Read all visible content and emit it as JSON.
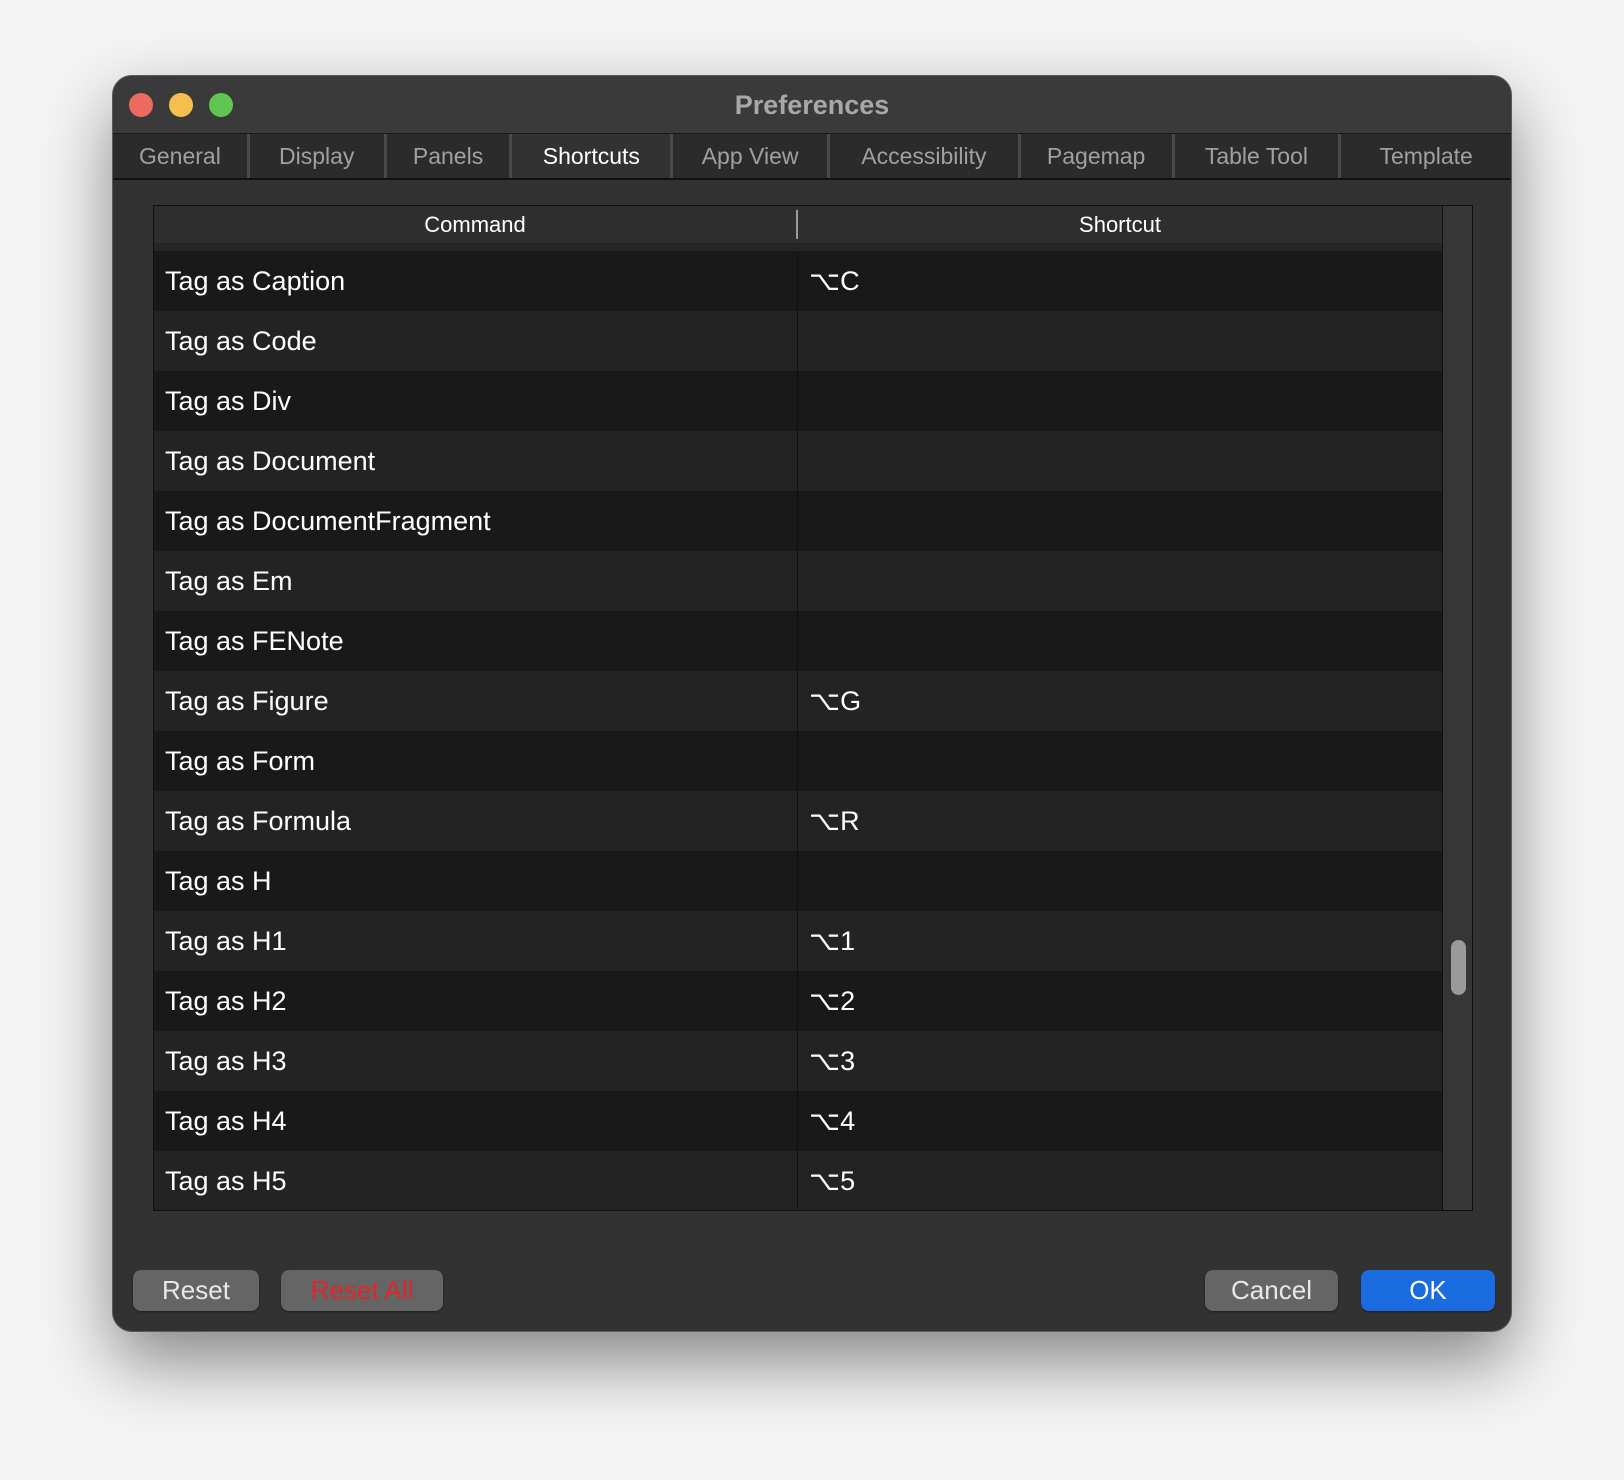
{
  "window": {
    "title": "Preferences"
  },
  "tabs": [
    {
      "label": "General"
    },
    {
      "label": "Display"
    },
    {
      "label": "Panels"
    },
    {
      "label": "Shortcuts"
    },
    {
      "label": "App View"
    },
    {
      "label": "Accessibility"
    },
    {
      "label": "Pagemap"
    },
    {
      "label": "Table Tool"
    },
    {
      "label": "Template"
    }
  ],
  "active_tab": "Shortcuts",
  "table": {
    "headers": [
      "Command",
      "Shortcut"
    ],
    "rows": [
      {
        "command": "Tag as Caption",
        "shortcut": "⌥C"
      },
      {
        "command": "Tag as Code",
        "shortcut": ""
      },
      {
        "command": "Tag as Div",
        "shortcut": ""
      },
      {
        "command": "Tag as Document",
        "shortcut": ""
      },
      {
        "command": "Tag as DocumentFragment",
        "shortcut": ""
      },
      {
        "command": "Tag as Em",
        "shortcut": ""
      },
      {
        "command": "Tag as FENote",
        "shortcut": ""
      },
      {
        "command": "Tag as Figure",
        "shortcut": "⌥G"
      },
      {
        "command": "Tag as Form",
        "shortcut": ""
      },
      {
        "command": "Tag as Formula",
        "shortcut": "⌥R"
      },
      {
        "command": "Tag as H",
        "shortcut": ""
      },
      {
        "command": "Tag as H1",
        "shortcut": "⌥1"
      },
      {
        "command": "Tag as H2",
        "shortcut": "⌥2"
      },
      {
        "command": "Tag as H3",
        "shortcut": "⌥3"
      },
      {
        "command": "Tag as H4",
        "shortcut": "⌥4"
      },
      {
        "command": "Tag as H5",
        "shortcut": "⌥5"
      }
    ]
  },
  "buttons": {
    "reset": "Reset",
    "reset_all": "Reset All",
    "cancel": "Cancel",
    "ok": "OK"
  },
  "colors": {
    "close": "#ec6a5e",
    "minimize": "#f4bf4f",
    "zoom": "#61c554",
    "accent": "#1a6ae0",
    "danger": "#e0262a"
  }
}
